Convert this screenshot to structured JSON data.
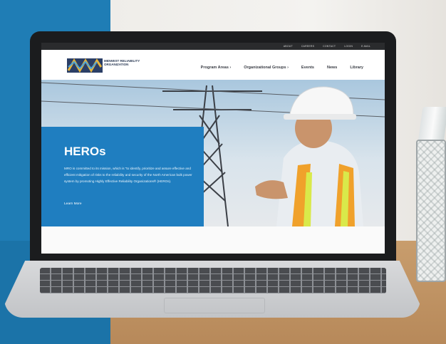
{
  "site": {
    "top_links": [
      "ABOUT",
      "CAREERS",
      "CONTACT",
      "LOGIN",
      "E-MAIL"
    ],
    "logo_text": "MIDWEST RELIABILITY ORGANIZATION",
    "nav": [
      "Program Areas ›",
      "Organizational Groups ›",
      "Events",
      "News",
      "Library"
    ]
  },
  "hero": {
    "title": "HEROs",
    "body": "MRO is committed to its mission, which is \"to identify, prioritize and assure effective and efficient mitigation of risks to the reliability and security of the North American bulk power system by promoting Highly Effective Reliability Organizations® (HEROs).",
    "link": "Learn More"
  },
  "colors": {
    "accent_blue": "#1f7ec0",
    "backdrop_blue": "#1f7db5",
    "nav_dark": "#2a2b2d"
  }
}
